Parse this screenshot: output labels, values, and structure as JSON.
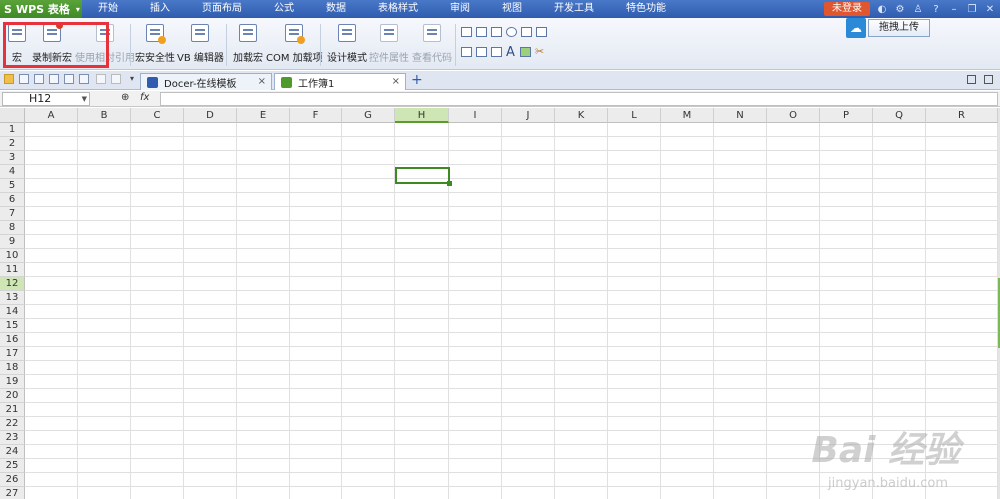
{
  "app": {
    "logo_mark": "S",
    "title": "WPS 表格",
    "caret": "▾"
  },
  "menu": [
    "开始",
    "插入",
    "页面布局",
    "公式",
    "数据",
    "表格样式",
    "审阅",
    "视图",
    "开发工具",
    "特色功能"
  ],
  "menu_right": {
    "login": "未登录",
    "help": "?"
  },
  "ribbon": {
    "buttons": [
      "宏",
      "录制新宏",
      "使用相对引用",
      "宏安全性",
      "VB 编辑器",
      "加载宏",
      "COM 加载项",
      "设计模式",
      "控件属性",
      "查看代码"
    ],
    "upload_label": "拖拽上传"
  },
  "tabs": [
    {
      "label": "Docer-在线模板",
      "close": "×"
    },
    {
      "label": "工作簿1",
      "close": "×"
    }
  ],
  "new_tab": "+",
  "formula_bar": {
    "cell_ref": "H12",
    "zoom_icon": "⊕",
    "fx": "fx",
    "value": ""
  },
  "columns": [
    "A",
    "B",
    "C",
    "D",
    "E",
    "F",
    "G",
    "H",
    "I",
    "J",
    "K",
    "L",
    "M",
    "N",
    "O",
    "P",
    "Q",
    "R"
  ],
  "rows": [
    "1",
    "2",
    "3",
    "4",
    "5",
    "6",
    "7",
    "8",
    "9",
    "10",
    "11",
    "12",
    "13",
    "14",
    "15",
    "16",
    "17",
    "18",
    "19",
    "20",
    "21",
    "22",
    "23",
    "24",
    "25",
    "26",
    "27"
  ],
  "selected": {
    "column": "H",
    "row": "12"
  },
  "watermark": {
    "brand": "Bai 经验",
    "url": "jingyan.baidu.com"
  }
}
